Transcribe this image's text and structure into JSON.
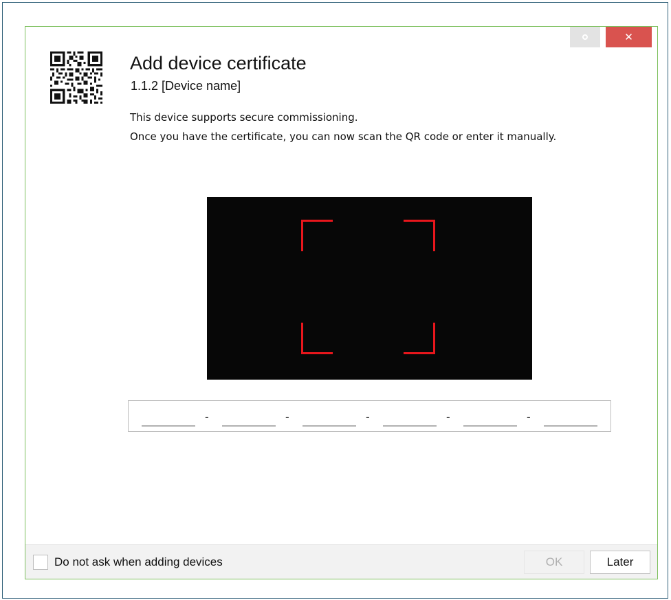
{
  "window": {
    "restore_icon": "circle-icon",
    "close_icon": "close-icon",
    "close_glyph": "✕"
  },
  "header": {
    "icon": "qr-code-icon",
    "title": "Add device certificate",
    "subtitle": "1.1.2 [Device name]"
  },
  "description": {
    "line1": "This device supports secure commissioning.",
    "line2": "Once you have the certificate, you can now scan the QR code or enter it manually."
  },
  "scanner": {
    "frame_color": "#e8161c",
    "background": "#070707"
  },
  "code_entry": {
    "slots": [
      "",
      "",
      "",
      "",
      "",
      ""
    ],
    "separator": "-"
  },
  "footer": {
    "checkbox_label": "Do not ask when adding devices",
    "checkbox_checked": false,
    "ok_label": "OK",
    "ok_enabled": false,
    "later_label": "Later"
  },
  "colors": {
    "dialog_border": "#7cbf5c",
    "close_button": "#d9534f",
    "outer_border": "#2f5f78"
  }
}
